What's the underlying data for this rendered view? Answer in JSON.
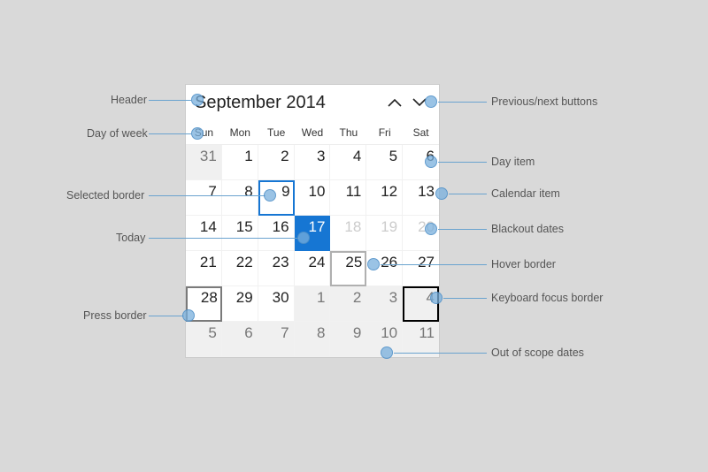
{
  "header": {
    "title": "September 2014"
  },
  "dow": [
    "Sun",
    "Mon",
    "Tue",
    "Wed",
    "Thu",
    "Fri",
    "Sat"
  ],
  "cells": [
    {
      "n": "31",
      "cls": "oos"
    },
    {
      "n": "1"
    },
    {
      "n": "2"
    },
    {
      "n": "3"
    },
    {
      "n": "4"
    },
    {
      "n": "5"
    },
    {
      "n": "6"
    },
    {
      "n": "7"
    },
    {
      "n": "8"
    },
    {
      "n": "9",
      "cls": "selected"
    },
    {
      "n": "10"
    },
    {
      "n": "11"
    },
    {
      "n": "12"
    },
    {
      "n": "13"
    },
    {
      "n": "14"
    },
    {
      "n": "15"
    },
    {
      "n": "16"
    },
    {
      "n": "17",
      "cls": "today"
    },
    {
      "n": "18",
      "cls": "blackout"
    },
    {
      "n": "19",
      "cls": "blackout"
    },
    {
      "n": "20",
      "cls": "blackout"
    },
    {
      "n": "21"
    },
    {
      "n": "22"
    },
    {
      "n": "23"
    },
    {
      "n": "24"
    },
    {
      "n": "25",
      "cls": "hover"
    },
    {
      "n": "26"
    },
    {
      "n": "27"
    },
    {
      "n": "28",
      "cls": "press"
    },
    {
      "n": "29"
    },
    {
      "n": "30"
    },
    {
      "n": "1",
      "cls": "oos"
    },
    {
      "n": "2",
      "cls": "oos"
    },
    {
      "n": "3",
      "cls": "oos"
    },
    {
      "n": "4",
      "cls": "oos focus"
    },
    {
      "n": "5",
      "cls": "oos"
    },
    {
      "n": "6",
      "cls": "oos"
    },
    {
      "n": "7",
      "cls": "oos"
    },
    {
      "n": "8",
      "cls": "oos"
    },
    {
      "n": "9",
      "cls": "oos"
    },
    {
      "n": "10",
      "cls": "oos"
    },
    {
      "n": "11",
      "cls": "oos"
    }
  ],
  "callouts": {
    "left": [
      {
        "id": "header",
        "label": "Header"
      },
      {
        "id": "dow",
        "label": "Day of week"
      },
      {
        "id": "selected",
        "label": "Selected border"
      },
      {
        "id": "today",
        "label": "Today"
      },
      {
        "id": "press",
        "label": "Press border"
      }
    ],
    "right": [
      {
        "id": "prevnext",
        "label": "Previous/next buttons"
      },
      {
        "id": "dayitem",
        "label": "Day item"
      },
      {
        "id": "calitem",
        "label": "Calendar item"
      },
      {
        "id": "blackout",
        "label": "Blackout dates"
      },
      {
        "id": "hoverb",
        "label": "Hover border"
      },
      {
        "id": "focusb",
        "label": "Keyboard focus border"
      },
      {
        "id": "oosd",
        "label": "Out of scope dates"
      }
    ]
  }
}
